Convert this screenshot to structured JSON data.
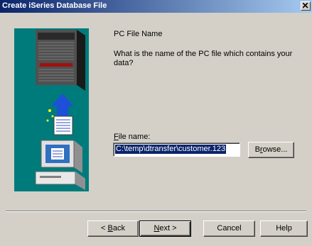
{
  "window": {
    "title": "Create iSeries Database File"
  },
  "main": {
    "heading": "PC File Name",
    "question": "What is the name of the PC file which contains your data?",
    "file_label_pre": "",
    "file_label_mnemonic": "F",
    "file_label_rest": "ile name:",
    "file_value": "C:\\temp\\dtransfer\\customer.123"
  },
  "buttons": {
    "browse_mnemonic": "r",
    "browse_pre": "B",
    "browse_post": "owse...",
    "back_pre": "< ",
    "back_mnemonic": "B",
    "back_post": "ack",
    "next_mnemonic": "N",
    "next_post": "ext >",
    "cancel": "Cancel",
    "help": "Help"
  },
  "icons": {
    "illustration": "server-transfer-illustration",
    "close": "close-icon"
  },
  "colors": {
    "titlebar_start": "#0a246a",
    "titlebar_end": "#a6caf0",
    "illustration_bg": "#007b7b",
    "selection": "#0a246a"
  }
}
